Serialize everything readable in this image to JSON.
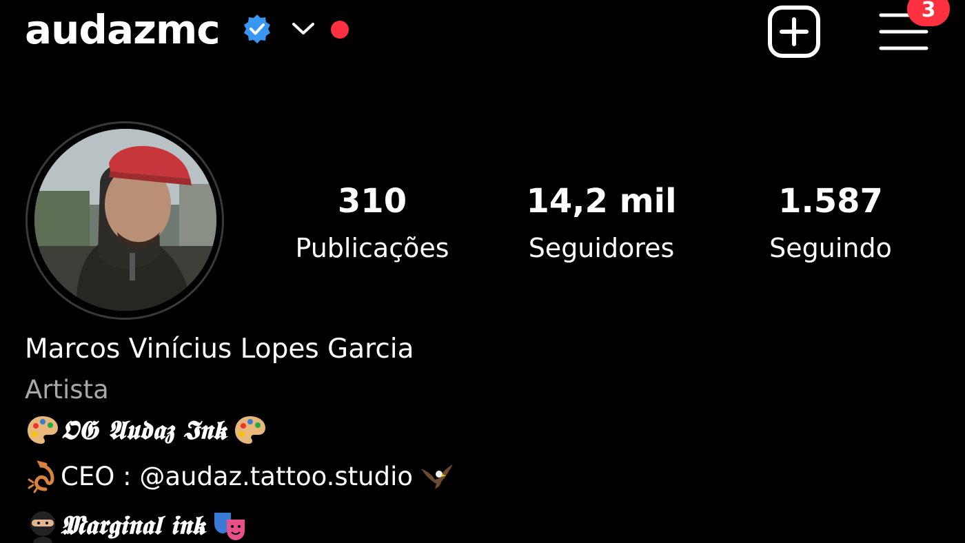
{
  "header": {
    "username": "audazmc",
    "menu_badge_count": "3",
    "icons": {
      "verified": "verified-badge-icon",
      "account_switch": "chevron-down-icon",
      "notification_dot": "red-dot-icon",
      "new_post": "plus-square-icon",
      "menu": "hamburger-menu-icon"
    }
  },
  "stats": {
    "posts": {
      "value": "310",
      "label": "Publicações"
    },
    "followers": {
      "value": "14,2 mil",
      "label": "Seguidores"
    },
    "following": {
      "value": "1.587",
      "label": "Seguindo"
    }
  },
  "bio": {
    "name": "Marcos Vinícius Lopes Garcia",
    "category": "Artista",
    "line1_text": "𝕺𝕲 𝕬𝖚𝖉𝖆𝖟 𝕴𝖓𝖐",
    "line2_text": "CEO : @audaz.tattoo.studio",
    "line3_text": "𝕸𝖆𝖗𝖌𝖎𝖓𝖆𝖑 𝖎𝖓𝖐",
    "emoji_icons": [
      "palette-icon",
      "scorpion-icon",
      "eagle-icon",
      "ninja-icon",
      "theater-masks-icon"
    ]
  },
  "colors": {
    "background": "#000000",
    "text": "#ffffff",
    "secondary_text": "#a8a8a8",
    "verified_blue": "#3897f0",
    "badge_red": "#ff3040"
  }
}
